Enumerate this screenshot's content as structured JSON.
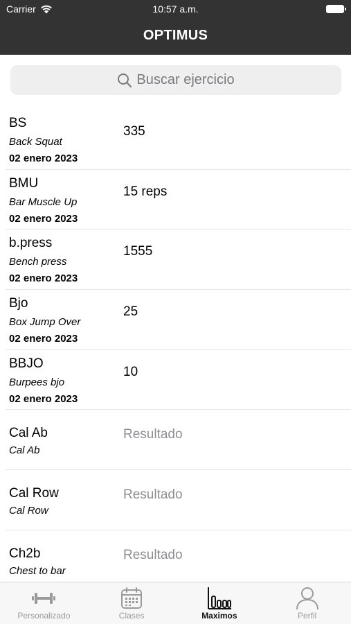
{
  "status_bar": {
    "carrier": "Carrier",
    "time": "10:57 a.m."
  },
  "header": {
    "title": "OPTIMUS"
  },
  "search": {
    "placeholder": "Buscar ejercicio"
  },
  "exercises": [
    {
      "abbr": "BS",
      "name": "Back Squat",
      "date": "02 enero 2023",
      "value": "335"
    },
    {
      "abbr": "BMU",
      "name": "Bar Muscle Up",
      "date": "02 enero 2023",
      "value": "15 reps"
    },
    {
      "abbr": "b.press",
      "name": "Bench press",
      "date": "02 enero 2023",
      "value": "1555"
    },
    {
      "abbr": "Bjo",
      "name": "Box Jump Over",
      "date": "02 enero 2023",
      "value": "25"
    },
    {
      "abbr": "BBJO",
      "name": "Burpees bjo",
      "date": "02 enero 2023",
      "value": "10"
    },
    {
      "abbr": "Cal Ab",
      "name": "Cal Ab",
      "placeholder": "Resultado"
    },
    {
      "abbr": "Cal Row",
      "name": "Cal Row",
      "placeholder": "Resultado"
    },
    {
      "abbr": "Ch2b",
      "name": "Chest to bar",
      "placeholder": "Resultado"
    }
  ],
  "tabbar": {
    "items": [
      {
        "label": "Personalizado",
        "icon": "dumbbell-icon"
      },
      {
        "label": "Clases",
        "icon": "calendar-icon"
      },
      {
        "label": "Maximos",
        "icon": "bar-chart-icon",
        "active": true
      },
      {
        "label": "Perfil",
        "icon": "person-icon"
      }
    ]
  },
  "colors": {
    "header_bg": "#333333",
    "tab_active": "#111111",
    "tab_inactive": "#9a9a9a"
  }
}
